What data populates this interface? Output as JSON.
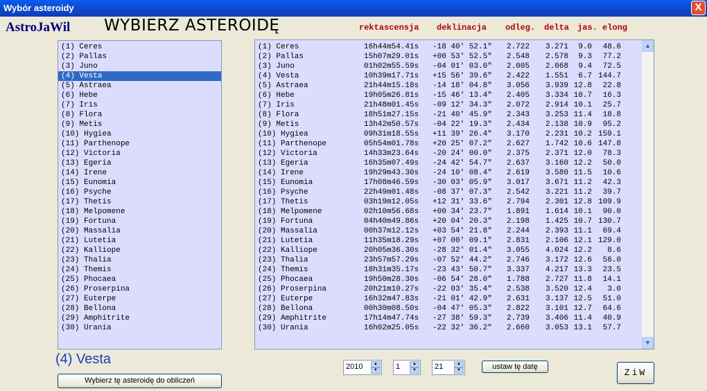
{
  "window": {
    "title": "Wybór asteroidy",
    "close_glyph": "X"
  },
  "header": {
    "logo": "AstroJaWil",
    "heading": "WYBIERZ ASTEROIDĘ",
    "columns": {
      "ra": "rektascensja",
      "dec": "deklinacja",
      "dist": "odleg.",
      "delta": "delta",
      "mag": "jas.",
      "elong": "elong"
    }
  },
  "list": {
    "selected_index": 3,
    "items": [
      "(1) Ceres",
      "(2) Pallas",
      "(3) Juno",
      "(4) Vesta",
      "(5) Astraea",
      "(6) Hebe",
      "(7) Iris",
      "(8) Flora",
      "(9) Metis",
      "(10) Hygiea",
      "(11) Parthenope",
      "(12) Victoria",
      "(13) Egeria",
      "(14) Irene",
      "(15) Eunomia",
      "(16) Psyche",
      "(17) Thetis",
      "(18) Melpomene",
      "(19) Fortuna",
      "(20) Massalia",
      "(21) Lutetia",
      "(22) Kalliope",
      "(23) Thalia",
      "(24) Themis",
      "(25) Phocaea",
      "(26) Proserpina",
      "(27) Euterpe",
      "(28) Bellona",
      "(29) Amphitrite",
      "(30) Urania"
    ]
  },
  "table": {
    "rows": [
      {
        "name": "(1) Ceres",
        "ra": "16h44m54.41s",
        "dec": "-18 40' 52.1\"",
        "dist": "2.722",
        "delta": "3.271",
        "mag": "9.0",
        "elong": "48.6"
      },
      {
        "name": "(2) Pallas",
        "ra": "15h07m29.01s",
        "dec": "+00 53' 52.5\"",
        "dist": "2.548",
        "delta": "2.578",
        "mag": "9.3",
        "elong": "77.2"
      },
      {
        "name": "(3) Juno",
        "ra": "01h02m55.59s",
        "dec": "-04 01' 03.0\"",
        "dist": "2.005",
        "delta": "2.068",
        "mag": "9.4",
        "elong": "72.5"
      },
      {
        "name": "(4) Vesta",
        "ra": "10h39m17.71s",
        "dec": "+15 56' 39.6\"",
        "dist": "2.422",
        "delta": "1.551",
        "mag": "6.7",
        "elong": "144.7"
      },
      {
        "name": "(5) Astraea",
        "ra": "21h44m15.18s",
        "dec": "-14 18' 04.8\"",
        "dist": "3.056",
        "delta": "3.939",
        "mag": "12.8",
        "elong": "22.8"
      },
      {
        "name": "(6) Hebe",
        "ra": "19h05m26.81s",
        "dec": "-15 46' 13.4\"",
        "dist": "2.405",
        "delta": "3.334",
        "mag": "10.7",
        "elong": "16.3"
      },
      {
        "name": "(7) Iris",
        "ra": "21h48m01.45s",
        "dec": "-09 12' 34.3\"",
        "dist": "2.072",
        "delta": "2.914",
        "mag": "10.1",
        "elong": "25.7"
      },
      {
        "name": "(8) Flora",
        "ra": "18h51m27.15s",
        "dec": "-21 40' 45.9\"",
        "dist": "2.343",
        "delta": "3.253",
        "mag": "11.4",
        "elong": "18.8"
      },
      {
        "name": "(9) Metis",
        "ra": "13h42m50.57s",
        "dec": "-04 22' 19.3\"",
        "dist": "2.434",
        "delta": "2.138",
        "mag": "10.9",
        "elong": "95.2"
      },
      {
        "name": "(10) Hygiea",
        "ra": "09h31m18.55s",
        "dec": "+11 39' 26.4\"",
        "dist": "3.170",
        "delta": "2.231",
        "mag": "10.2",
        "elong": "159.1"
      },
      {
        "name": "(11) Parthenope",
        "ra": "05h54m01.78s",
        "dec": "+20 25' 07.2\"",
        "dist": "2.627",
        "delta": "1.742",
        "mag": "10.6",
        "elong": "147.8"
      },
      {
        "name": "(12) Victoria",
        "ra": "14h33m23.64s",
        "dec": "-20 24' 00.0\"",
        "dist": "2.375",
        "delta": "2.371",
        "mag": "12.0",
        "elong": "78.3"
      },
      {
        "name": "(13) Egeria",
        "ra": "16h35m07.49s",
        "dec": "-24 42' 54.7\"",
        "dist": "2.637",
        "delta": "3.160",
        "mag": "12.2",
        "elong": "50.0"
      },
      {
        "name": "(14) Irene",
        "ra": "19h29m43.30s",
        "dec": "-24 10' 08.4\"",
        "dist": "2.619",
        "delta": "3.580",
        "mag": "11.5",
        "elong": "10.6"
      },
      {
        "name": "(15) Eunomia",
        "ra": "17h08m46.59s",
        "dec": "-30 03' 05.9\"",
        "dist": "3.017",
        "delta": "3.671",
        "mag": "11.2",
        "elong": "42.3"
      },
      {
        "name": "(16) Psyche",
        "ra": "22h49m01.48s",
        "dec": "-08 37' 07.3\"",
        "dist": "2.542",
        "delta": "3.221",
        "mag": "11.2",
        "elong": "39.7"
      },
      {
        "name": "(17) Thetis",
        "ra": "03h19m12.05s",
        "dec": "+12 31' 33.6\"",
        "dist": "2.794",
        "delta": "2.301",
        "mag": "12.8",
        "elong": "109.9"
      },
      {
        "name": "(18) Melpomene",
        "ra": "02h10m56.68s",
        "dec": "+00 34' 23.7\"",
        "dist": "1.891",
        "delta": "1.614",
        "mag": "10.1",
        "elong": "90.0"
      },
      {
        "name": "(19) Fortuna",
        "ra": "04h40m49.86s",
        "dec": "+20 04' 20.3\"",
        "dist": "2.198",
        "delta": "1.425",
        "mag": "10.7",
        "elong": "130.7"
      },
      {
        "name": "(20) Massalia",
        "ra": "00h37m12.12s",
        "dec": "+03 54' 21.8\"",
        "dist": "2.244",
        "delta": "2.393",
        "mag": "11.1",
        "elong": "69.4"
      },
      {
        "name": "(21) Lutetia",
        "ra": "11h35m18.29s",
        "dec": "+07 00' 09.1\"",
        "dist": "2.831",
        "delta": "2.106",
        "mag": "12.1",
        "elong": "129.0"
      },
      {
        "name": "(22) Kalliope",
        "ra": "20h05m36.30s",
        "dec": "-28 32' 01.4\"",
        "dist": "3.055",
        "delta": "4.024",
        "mag": "12.2",
        "elong": "8.6"
      },
      {
        "name": "(23) Thalia",
        "ra": "23h57m57.29s",
        "dec": "-07 52' 44.2\"",
        "dist": "2.746",
        "delta": "3.172",
        "mag": "12.6",
        "elong": "56.0"
      },
      {
        "name": "(24) Themis",
        "ra": "18h31m35.17s",
        "dec": "-23 43' 50.7\"",
        "dist": "3.337",
        "delta": "4.217",
        "mag": "13.3",
        "elong": "23.5"
      },
      {
        "name": "(25) Phocaea",
        "ra": "19h50m28.30s",
        "dec": "-06 54' 28.0\"",
        "dist": "1.788",
        "delta": "2.727",
        "mag": "11.8",
        "elong": "14.1"
      },
      {
        "name": "(26) Proserpina",
        "ra": "20h21m10.27s",
        "dec": "-22 03' 35.4\"",
        "dist": "2.538",
        "delta": "3.520",
        "mag": "12.4",
        "elong": "3.0"
      },
      {
        "name": "(27) Euterpe",
        "ra": "16h32m47.83s",
        "dec": "-21 01' 42.9\"",
        "dist": "2.631",
        "delta": "3.137",
        "mag": "12.5",
        "elong": "51.0"
      },
      {
        "name": "(28) Bellona",
        "ra": "00h30m08.50s",
        "dec": "-04 47' 05.3\"",
        "dist": "2.822",
        "delta": "3.101",
        "mag": "12.7",
        "elong": "64.6"
      },
      {
        "name": "(29) Amphitrite",
        "ra": "17h14m47.74s",
        "dec": "-27 38' 59.3\"",
        "dist": "2.739",
        "delta": "3.406",
        "mag": "11.4",
        "elong": "40.9"
      },
      {
        "name": "(30) Urania",
        "ra": "16h02m25.05s",
        "dec": "-22 32' 36.2\"",
        "dist": "2.660",
        "delta": "3.053",
        "mag": "13.1",
        "elong": "57.7"
      }
    ]
  },
  "selected": {
    "label": "(4) Vesta"
  },
  "buttons": {
    "choose": "Wybierz tę asteroidę do obliczeń",
    "set_date": "ustaw tę datę",
    "ziw": "ZiW"
  },
  "date": {
    "year": "2010",
    "month": "1",
    "day": "21"
  },
  "icons": {
    "close": "close-icon",
    "up": "scroll-up-arrow-icon",
    "down": "scroll-down-arrow-icon"
  },
  "colors": {
    "title_bar": "#0a46c8",
    "selection": "#316ac5",
    "list_bg": "#dcdcff",
    "header_red": "#b00000",
    "logo_navy": "#000080"
  }
}
